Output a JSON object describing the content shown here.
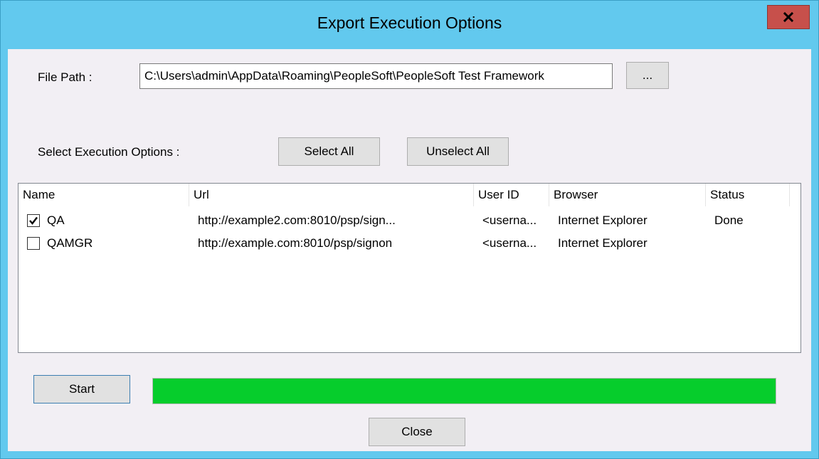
{
  "window": {
    "title": "Export Execution Options",
    "title_bar_color": "#62c9ee",
    "close_button_color": "#c7504b"
  },
  "file_path": {
    "label": "File Path :",
    "value": "C:\\Users\\admin\\AppData\\Roaming\\PeopleSoft\\PeopleSoft Test Framework",
    "browse_label": "..."
  },
  "options": {
    "label": "Select Execution Options :",
    "select_all_label": "Select All",
    "unselect_all_label": "Unselect All"
  },
  "table": {
    "columns": [
      "Name",
      "Url",
      "User ID",
      "Browser",
      "Status"
    ],
    "rows": [
      {
        "checked": true,
        "name": "QA",
        "url": "http://example2.com:8010/psp/sign...",
        "user_id": "<userna...",
        "browser": "Internet Explorer",
        "status": "Done"
      },
      {
        "checked": false,
        "name": "QAMGR",
        "url": "http://example.com:8010/psp/signon",
        "user_id": "<userna...",
        "browser": "Internet Explorer",
        "status": ""
      }
    ]
  },
  "footer": {
    "start_label": "Start",
    "close_label": "Close",
    "progress_percent": 100,
    "progress_color": "#06cd2c"
  }
}
